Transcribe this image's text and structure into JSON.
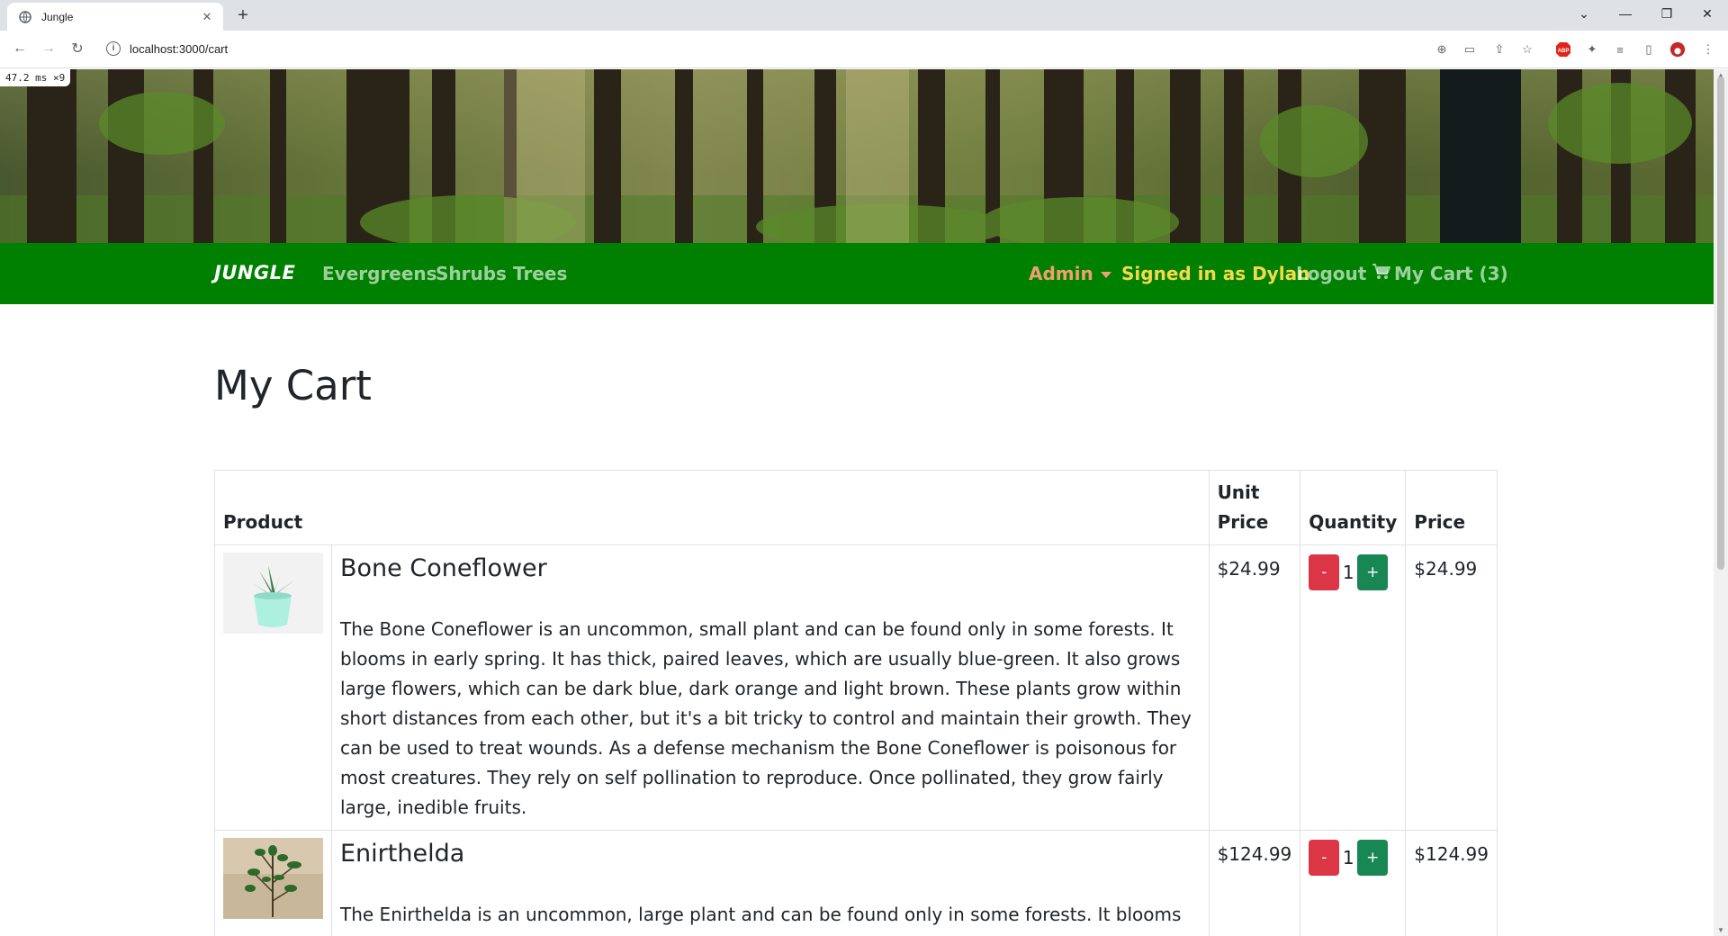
{
  "browser": {
    "tab_title": "Jungle",
    "url": "localhost:3000/cart",
    "timing_badge": "47.2 ms ×9"
  },
  "nav": {
    "brand": "JUNGLE",
    "links": [
      "Evergreens",
      "Shrubs",
      "Trees"
    ],
    "admin": "Admin",
    "signed_in": "Signed in as Dylan",
    "logout": "Logout",
    "cart": "My Cart (3)"
  },
  "page": {
    "title": "My Cart"
  },
  "table": {
    "headers": {
      "product": "Product",
      "unit_price": "Unit Price",
      "quantity": "Quantity",
      "price": "Price"
    },
    "rows": [
      {
        "name": "Bone Coneflower",
        "description": "The Bone Coneflower is an uncommon, small plant and can be found only in some forests. It blooms in early spring. It has thick, paired leaves, which are usually blue-green. It also grows large flowers, which can be dark blue, dark orange and light brown. These plants grow within short distances from each other, but it's a bit tricky to control and maintain their growth. They can be used to treat wounds. As a defense mechanism the Bone Coneflower is poisonous for most creatures. They rely on self pollination to reproduce. Once pollinated, they grow fairly large, inedible fruits.",
        "unit_price": "$24.99",
        "quantity": "1",
        "price": "$24.99",
        "minus": "-",
        "plus": "+"
      },
      {
        "name": "Enirthelda",
        "description": "The Enirthelda is an uncommon, large plant and can be found only in some forests. It blooms once a year,",
        "unit_price": "$124.99",
        "quantity": "1",
        "price": "$124.99",
        "minus": "-",
        "plus": "+"
      }
    ]
  },
  "colors": {
    "navbar": "#008000",
    "admin": "#f0a070",
    "signed_in": "#f5d94a",
    "minus_button": "#dc3545",
    "plus_button": "#198754"
  }
}
